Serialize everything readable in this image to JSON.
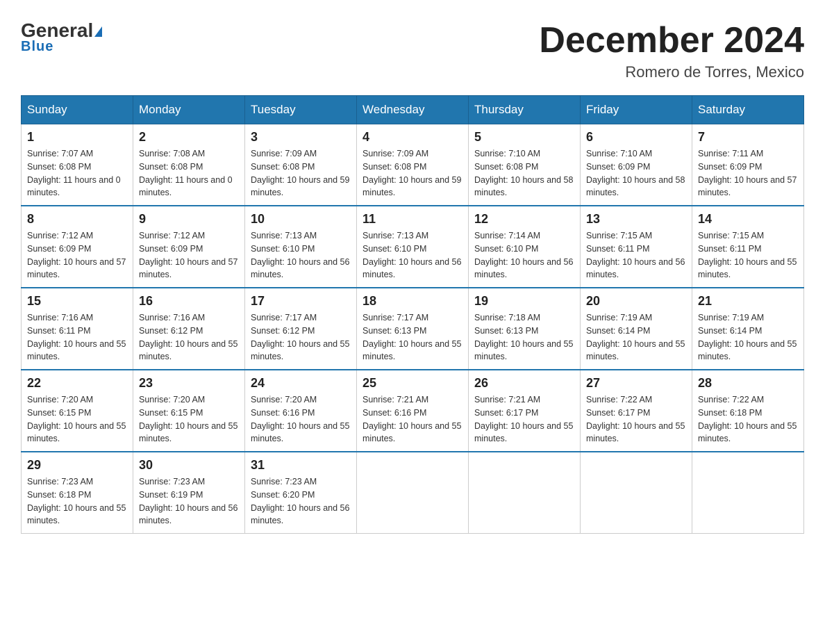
{
  "header": {
    "logo_general": "General",
    "logo_blue": "Blue",
    "month_title": "December 2024",
    "location": "Romero de Torres, Mexico"
  },
  "days_of_week": [
    "Sunday",
    "Monday",
    "Tuesday",
    "Wednesday",
    "Thursday",
    "Friday",
    "Saturday"
  ],
  "weeks": [
    [
      {
        "day": "1",
        "sunrise": "7:07 AM",
        "sunset": "6:08 PM",
        "daylight": "11 hours and 0 minutes."
      },
      {
        "day": "2",
        "sunrise": "7:08 AM",
        "sunset": "6:08 PM",
        "daylight": "11 hours and 0 minutes."
      },
      {
        "day": "3",
        "sunrise": "7:09 AM",
        "sunset": "6:08 PM",
        "daylight": "10 hours and 59 minutes."
      },
      {
        "day": "4",
        "sunrise": "7:09 AM",
        "sunset": "6:08 PM",
        "daylight": "10 hours and 59 minutes."
      },
      {
        "day": "5",
        "sunrise": "7:10 AM",
        "sunset": "6:08 PM",
        "daylight": "10 hours and 58 minutes."
      },
      {
        "day": "6",
        "sunrise": "7:10 AM",
        "sunset": "6:09 PM",
        "daylight": "10 hours and 58 minutes."
      },
      {
        "day": "7",
        "sunrise": "7:11 AM",
        "sunset": "6:09 PM",
        "daylight": "10 hours and 57 minutes."
      }
    ],
    [
      {
        "day": "8",
        "sunrise": "7:12 AM",
        "sunset": "6:09 PM",
        "daylight": "10 hours and 57 minutes."
      },
      {
        "day": "9",
        "sunrise": "7:12 AM",
        "sunset": "6:09 PM",
        "daylight": "10 hours and 57 minutes."
      },
      {
        "day": "10",
        "sunrise": "7:13 AM",
        "sunset": "6:10 PM",
        "daylight": "10 hours and 56 minutes."
      },
      {
        "day": "11",
        "sunrise": "7:13 AM",
        "sunset": "6:10 PM",
        "daylight": "10 hours and 56 minutes."
      },
      {
        "day": "12",
        "sunrise": "7:14 AM",
        "sunset": "6:10 PM",
        "daylight": "10 hours and 56 minutes."
      },
      {
        "day": "13",
        "sunrise": "7:15 AM",
        "sunset": "6:11 PM",
        "daylight": "10 hours and 56 minutes."
      },
      {
        "day": "14",
        "sunrise": "7:15 AM",
        "sunset": "6:11 PM",
        "daylight": "10 hours and 55 minutes."
      }
    ],
    [
      {
        "day": "15",
        "sunrise": "7:16 AM",
        "sunset": "6:11 PM",
        "daylight": "10 hours and 55 minutes."
      },
      {
        "day": "16",
        "sunrise": "7:16 AM",
        "sunset": "6:12 PM",
        "daylight": "10 hours and 55 minutes."
      },
      {
        "day": "17",
        "sunrise": "7:17 AM",
        "sunset": "6:12 PM",
        "daylight": "10 hours and 55 minutes."
      },
      {
        "day": "18",
        "sunrise": "7:17 AM",
        "sunset": "6:13 PM",
        "daylight": "10 hours and 55 minutes."
      },
      {
        "day": "19",
        "sunrise": "7:18 AM",
        "sunset": "6:13 PM",
        "daylight": "10 hours and 55 minutes."
      },
      {
        "day": "20",
        "sunrise": "7:19 AM",
        "sunset": "6:14 PM",
        "daylight": "10 hours and 55 minutes."
      },
      {
        "day": "21",
        "sunrise": "7:19 AM",
        "sunset": "6:14 PM",
        "daylight": "10 hours and 55 minutes."
      }
    ],
    [
      {
        "day": "22",
        "sunrise": "7:20 AM",
        "sunset": "6:15 PM",
        "daylight": "10 hours and 55 minutes."
      },
      {
        "day": "23",
        "sunrise": "7:20 AM",
        "sunset": "6:15 PM",
        "daylight": "10 hours and 55 minutes."
      },
      {
        "day": "24",
        "sunrise": "7:20 AM",
        "sunset": "6:16 PM",
        "daylight": "10 hours and 55 minutes."
      },
      {
        "day": "25",
        "sunrise": "7:21 AM",
        "sunset": "6:16 PM",
        "daylight": "10 hours and 55 minutes."
      },
      {
        "day": "26",
        "sunrise": "7:21 AM",
        "sunset": "6:17 PM",
        "daylight": "10 hours and 55 minutes."
      },
      {
        "day": "27",
        "sunrise": "7:22 AM",
        "sunset": "6:17 PM",
        "daylight": "10 hours and 55 minutes."
      },
      {
        "day": "28",
        "sunrise": "7:22 AM",
        "sunset": "6:18 PM",
        "daylight": "10 hours and 55 minutes."
      }
    ],
    [
      {
        "day": "29",
        "sunrise": "7:23 AM",
        "sunset": "6:18 PM",
        "daylight": "10 hours and 55 minutes."
      },
      {
        "day": "30",
        "sunrise": "7:23 AM",
        "sunset": "6:19 PM",
        "daylight": "10 hours and 56 minutes."
      },
      {
        "day": "31",
        "sunrise": "7:23 AM",
        "sunset": "6:20 PM",
        "daylight": "10 hours and 56 minutes."
      },
      null,
      null,
      null,
      null
    ]
  ],
  "labels": {
    "sunrise": "Sunrise:",
    "sunset": "Sunset:",
    "daylight": "Daylight:"
  }
}
